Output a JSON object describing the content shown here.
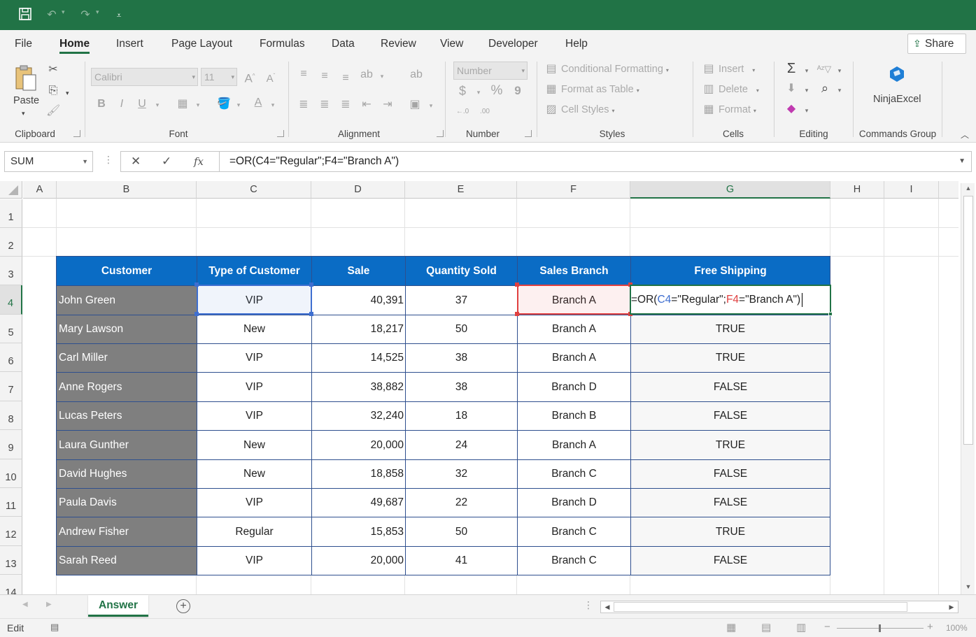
{
  "qat": {
    "save_icon": "save-icon",
    "undo_icon": "undo-icon",
    "redo_icon": "redo-icon",
    "customize_icon": "customize-qat-icon"
  },
  "ribbon_tabs": [
    "File",
    "Home",
    "Insert",
    "Page Layout",
    "Formulas",
    "Data",
    "Review",
    "View",
    "Developer",
    "Help"
  ],
  "active_tab": "Home",
  "share_label": "Share",
  "ribbon": {
    "clipboard": {
      "paste_label": "Paste",
      "group_label": "Clipboard"
    },
    "font": {
      "font_name": "Calibri",
      "font_size": "11",
      "bold": "B",
      "italic": "I",
      "underline": "U",
      "group_label": "Font"
    },
    "alignment": {
      "group_label": "Alignment"
    },
    "number": {
      "format": "Number",
      "currency": "$",
      "percent": "%",
      "comma": "9",
      "group_label": "Number"
    },
    "styles": {
      "conditional": "Conditional Formatting",
      "format_table": "Format as Table",
      "cell_styles": "Cell Styles",
      "group_label": "Styles"
    },
    "cells": {
      "insert": "Insert",
      "delete": "Delete",
      "format": "Format",
      "group_label": "Cells"
    },
    "editing": {
      "group_label": "Editing"
    },
    "commands": {
      "addin_label": "NinjaExcel",
      "group_label": "Commands Group"
    }
  },
  "formula_bar": {
    "name_box": "SUM",
    "formula": "=OR(C4=\"Regular\";F4=\"Branch A\")"
  },
  "columns": [
    "A",
    "B",
    "C",
    "D",
    "E",
    "F",
    "G",
    "H",
    "I"
  ],
  "rows": [
    "1",
    "2",
    "3",
    "4",
    "5",
    "6",
    "7",
    "8",
    "9",
    "10",
    "11",
    "12",
    "13",
    "14"
  ],
  "table": {
    "headers": [
      "Customer",
      "Type of Customer",
      "Sale",
      "Quantity Sold",
      "Sales Branch",
      "Free Shipping"
    ],
    "rows": [
      [
        "John Green",
        "VIP",
        "40,391",
        "37",
        "Branch A",
        ""
      ],
      [
        "Mary Lawson",
        "New",
        "18,217",
        "50",
        "Branch A",
        "TRUE"
      ],
      [
        "Carl Miller",
        "VIP",
        "14,525",
        "38",
        "Branch A",
        "TRUE"
      ],
      [
        "Anne Rogers",
        "VIP",
        "38,882",
        "38",
        "Branch D",
        "FALSE"
      ],
      [
        "Lucas Peters",
        "VIP",
        "32,240",
        "18",
        "Branch B",
        "FALSE"
      ],
      [
        "Laura Gunther",
        "New",
        "20,000",
        "24",
        "Branch A",
        "TRUE"
      ],
      [
        "David Hughes",
        "New",
        "18,858",
        "32",
        "Branch C",
        "FALSE"
      ],
      [
        "Paula Davis",
        "VIP",
        "49,687",
        "22",
        "Branch D",
        "FALSE"
      ],
      [
        "Andrew Fisher",
        "Regular",
        "15,853",
        "50",
        "Branch C",
        "TRUE"
      ],
      [
        "Sarah Reed",
        "VIP",
        "20,000",
        "41",
        "Branch C",
        "FALSE"
      ]
    ]
  },
  "editing_cell": {
    "p1": "=OR(",
    "ref1": "C4",
    "p2": "=\"Regular\";",
    "ref2": "F4",
    "p3": "=\"Branch A\")"
  },
  "sheet_tabs": [
    "Answer"
  ],
  "status": {
    "mode": "Edit",
    "zoom": "100%"
  },
  "colors": {
    "excel_green": "#217346",
    "header_blue": "#0a6cc5",
    "name_gray": "#7f7f7f",
    "ref_blue": "#3f6fd0",
    "ref_red": "#e04040"
  }
}
